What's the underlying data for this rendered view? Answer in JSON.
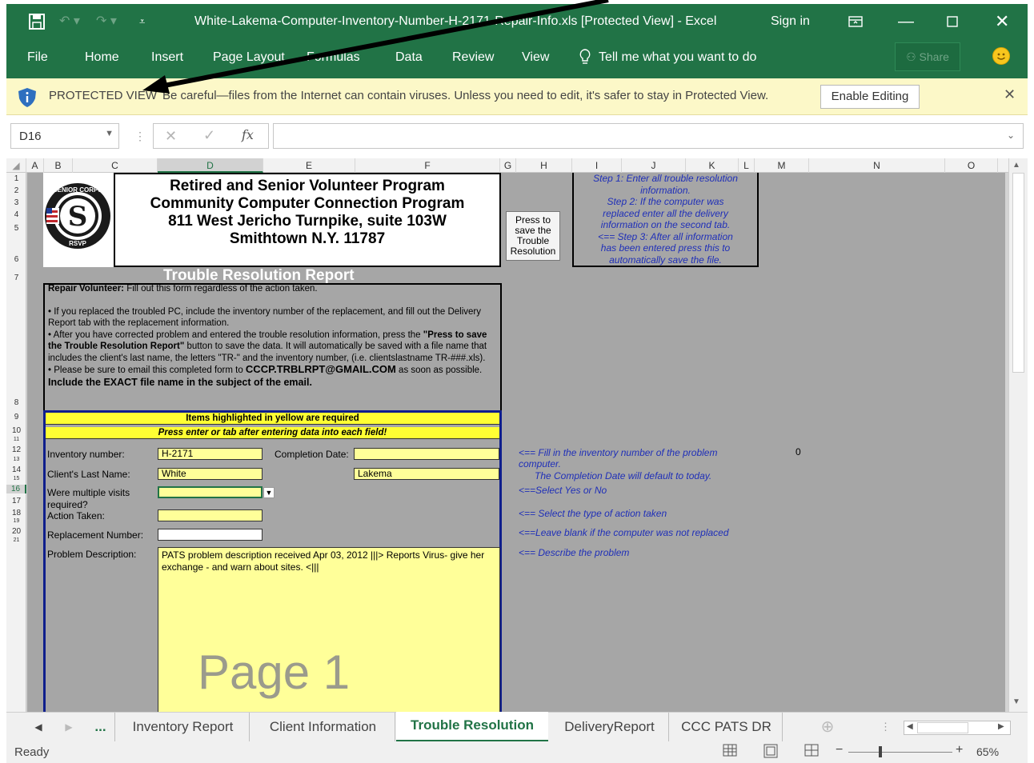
{
  "title_bar": {
    "document_title": "White-Lakema-Computer-Inventory-Number-H-2171-Repair-Info.xls  [Protected View]  -  Excel",
    "sign_in": "Sign in"
  },
  "ribbon": {
    "tabs": [
      "File",
      "Home",
      "Insert",
      "Page Layout",
      "Formulas",
      "Data",
      "Review",
      "View"
    ],
    "tell_me": "Tell me what you want to do",
    "share": "Share"
  },
  "protected_view": {
    "title": "PROTECTED VIEW",
    "message": "Be careful—files from the Internet can contain viruses. Unless you need to edit, it's safer to stay in Protected View.",
    "enable_button": "Enable Editing"
  },
  "formula_bar": {
    "name_box": "D16",
    "fx": "fx",
    "content": ""
  },
  "columns": [
    "A",
    "B",
    "C",
    "D",
    "E",
    "F",
    "G",
    "H",
    "I",
    "J",
    "K",
    "L",
    "M",
    "N",
    "O"
  ],
  "rows": [
    "1",
    "2",
    "3",
    "4",
    "5",
    "6",
    "7",
    "8",
    "9",
    "10",
    "11",
    "12",
    "13",
    "14",
    "15",
    "16",
    "17",
    "18",
    "19",
    "20",
    "21"
  ],
  "header": {
    "line1": "Retired and Senior Volunteer Program",
    "line2": "Community Computer Connection Program",
    "line3": "811 West Jericho Turnpike, suite 103W",
    "line4": "Smithtown N.Y. 11787"
  },
  "logo": {
    "top_text": "SENIOR CORPS",
    "letter": "S",
    "bottom_text": "RSVP"
  },
  "save_button": {
    "line1": "Press to",
    "line2": "save the",
    "line3": "Trouble",
    "line4": "Resolution"
  },
  "steps": {
    "line1": "Step 1: Enter all trouble resolution",
    "line2": "information.",
    "line3": "Step 2: If the computer was",
    "line4": "replaced enter all the delivery",
    "line5": "information on the second tab.",
    "line6": "<== Step 3: After all information",
    "line7": "has been entered press this to",
    "line8": "automatically save the file."
  },
  "report_title": "Trouble Resolution Report",
  "instructions": {
    "label": "Repair Volunteer:",
    "label_rest": " Fill out this form regardless of the action taken.",
    "bullet1": "• If you replaced the troubled PC, include the inventory number of the replacement, and fill out the Delivery Report tab with the replacement information.",
    "bullet2a": "• After you have corrected problem and entered the trouble resolution information, press the ",
    "bullet2b": "\"Press to save the Trouble Resolution Report\"",
    "bullet2c": " button to save the data. It will automatically be saved with a file name that includes the client's last name, the letters \"TR-\" and the inventory number, (i.e. clientslastname TR-###.xls).",
    "bullet3a": "• Please be sure to email this completed form to ",
    "bullet3_email": "CCCP.TRBLRPT@GMAIL.COM",
    "bullet3b": " as soon as possible.",
    "bold_line": "Include the EXACT file name in the subject of the email."
  },
  "banners": {
    "required": "Items highlighted in yellow are required",
    "press_enter": "Press enter or tab after entering data into each field!"
  },
  "form": {
    "inventory_label": "Inventory number:",
    "inventory_value": "H-2171",
    "completion_label": "Completion Date:",
    "completion_value": "",
    "client_label": "Client's Last Name:",
    "client_value1": "White",
    "client_value2": "Lakema",
    "visits_label1": "Were multiple visits",
    "visits_label2": "required?",
    "visits_value": "",
    "action_label": "Action Taken:",
    "action_value": "",
    "replacement_label": "Replacement Number:",
    "replacement_value": "",
    "problem_label": "Problem Description:",
    "problem_value": "PATS problem description received Apr 03, 2012 |||> Reports Virus- give her exchange -  and warn about sites. <|||"
  },
  "hints": {
    "inventory1": "<== Fill in the inventory number of the problem",
    "inventory2": "computer.",
    "completion": "The Completion Date will default to today.",
    "visits": "<==Select Yes or No",
    "action": "<==  Select the type of action taken",
    "replacement": "<==Leave blank if the computer was not replaced",
    "problem": "<== Describe the problem",
    "zero": "0"
  },
  "page_watermark": "Page 1",
  "sheet_tabs": {
    "ellipsis": "...",
    "inventory": "Inventory Report",
    "client": "Client Information",
    "trouble": "Trouble Resolution",
    "delivery": "DeliveryReport",
    "pats": "CCC PATS DR"
  },
  "status": {
    "ready": "Ready",
    "zoom": "65%"
  },
  "colors": {
    "excel_green": "#217346",
    "required_yellow": "#ffff33",
    "field_yellow": "#ffff99",
    "hint_blue": "#1f2fb8"
  }
}
